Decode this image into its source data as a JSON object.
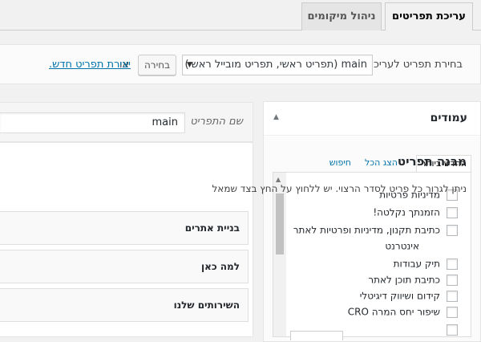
{
  "tabs": [
    {
      "label": "עריכת תפריטים",
      "active": true
    },
    {
      "label": "ניהול מיקומים",
      "active": false
    }
  ],
  "manage": {
    "label": "בחירת תפריט לעריכה:",
    "selected_menu": "main (תפריט ראשי, תפריט מובייל ראשי)",
    "select_button": "בחירה",
    "or_text": "או",
    "create_link": "יצירת תפריט חדש."
  },
  "sidebar": {
    "title": "עמודים",
    "tabs": [
      "החדש ביותר",
      "הצג הכל",
      "חיפוש"
    ],
    "items": [
      "מדיניות פרטיות",
      "הזמנתך נקלטה!",
      "כתיבת תקנון, מדיניות ופרטיות לאתר",
      "תיק עבודות",
      "כתיבת תוכן לאתר",
      "קידום ושיווק דיגיטלי",
      "שיפור יחס המרה CRO"
    ],
    "wrap_continuation": "אינטרנט"
  },
  "menu_name": {
    "label": "שם התפריט",
    "value": "main"
  },
  "structure": {
    "title": "מבנה תפריט",
    "hint": "ניתן לגרור כל פריט לסדר הרצוי. יש ללחוץ על החץ בצד שמאל",
    "items": [
      "בניית אתרים",
      "למה כאן",
      "השירותים שלנו"
    ]
  }
}
